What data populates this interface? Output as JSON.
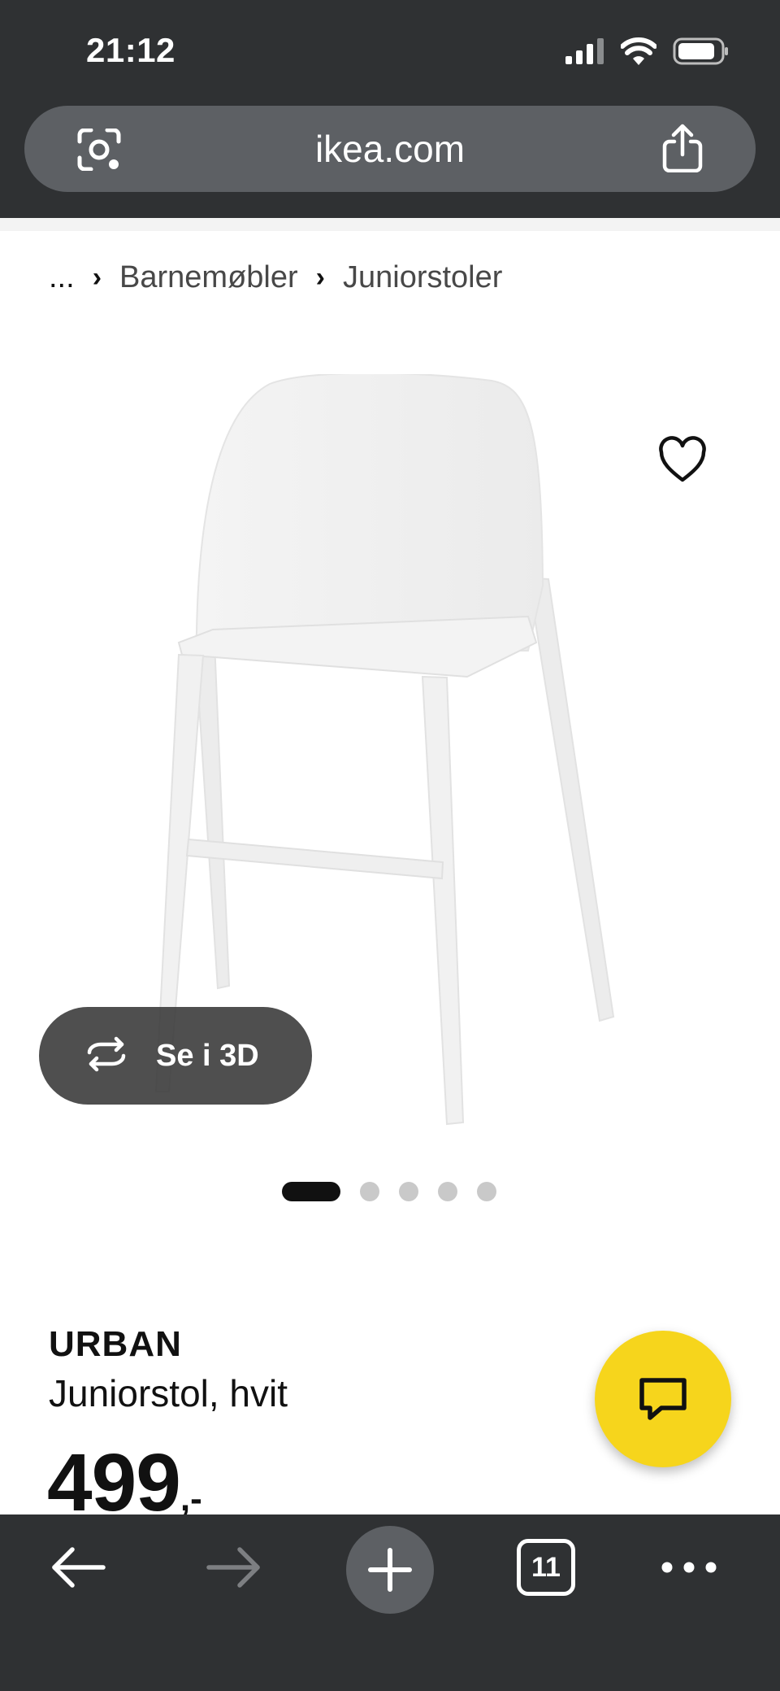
{
  "status_bar": {
    "time": "21:12"
  },
  "browser": {
    "url": "ikea.com",
    "tab_count": "11"
  },
  "breadcrumb": {
    "ellipsis": "...",
    "items": [
      "Barnemøbler",
      "Juniorstoler"
    ]
  },
  "gallery": {
    "view_3d_label": "Se i 3D",
    "image_count": 5,
    "active_index": 0
  },
  "product": {
    "name": "URBAN",
    "description": "Juniorstol, hvit",
    "price_integer": "499",
    "price_decimal": ",-"
  },
  "colors": {
    "chrome_bg": "#2f3133",
    "url_bar_bg": "#5d6064",
    "chat_fab": "#f6d51c",
    "text": "#111111"
  },
  "icons": {
    "url_left": "camera-search-icon",
    "url_right": "share-icon",
    "favorite": "heart-outline-icon",
    "view_3d": "rotate-3d-icon",
    "chat": "chat-bubble-icon",
    "back": "arrow-left-icon",
    "forward": "arrow-right-icon",
    "new_tab": "plus-icon",
    "more": "more-dots-icon"
  }
}
